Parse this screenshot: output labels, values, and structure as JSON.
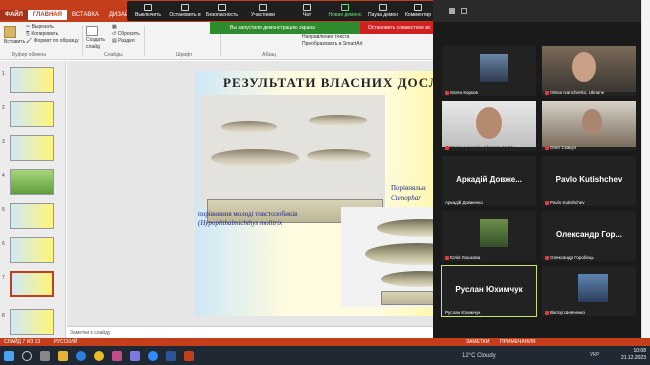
{
  "ribbon": {
    "tabs": [
      "ФАЙЛ",
      "ГЛАВНАЯ",
      "ВСТАВКА",
      "ДИЗАЙН"
    ],
    "paste_label": "Вставить",
    "cut_label": "Вырезать",
    "copy_label": "Копировать",
    "format_label": "Формат по образцу",
    "new_slide_label": "Создать слайд",
    "reset_label": "Сбросить",
    "section_label": "Раздел",
    "clipboard_group": "Буфер обмена",
    "slides_group": "Слайды",
    "font_group": "Шрифт",
    "paragraph_group": "Абзац",
    "text_direction": "Направление текста",
    "align_text": "Выровнять текст",
    "smartart": "Преобразовать в SmartArt"
  },
  "zoom_toolbar": {
    "items": [
      "Выключить",
      "Остановить в",
      "Безопасность",
      "Участники",
      "Чат",
      "Новая демонс",
      "Пауза демон",
      "Комментир"
    ],
    "share_bar": "Вы запустили демонстрацию экрана",
    "stop_button": "Остановить совместное ис"
  },
  "slide": {
    "title": "РЕЗУЛЬТАТИ ВЛАСНИХ ДОСЛІД",
    "caption_line1": "порівняння молоді товстолобиків",
    "caption_line2": "(Hypophthalmichthys molitrix",
    "compare_line1": "Порівняльн",
    "compare_line2": "Ctenophar"
  },
  "thumbnails": [
    "1",
    "2",
    "3",
    "4",
    "5",
    "6",
    "7",
    "8"
  ],
  "notes_placeholder": "Заметки к слайду",
  "status_bar": {
    "slide_info": "СЛАЙД 7 ИЗ 13",
    "language": "РУССКИЙ",
    "notes_btn": "ЗАМЕТКИ",
    "comments_btn": "ПРИМЕЧАНИЯ"
  },
  "participants": [
    {
      "name": "Євген Корков",
      "display": ""
    },
    {
      "name": "Olena Ivanchenko, Ukraine",
      "display": ""
    },
    {
      "name": "Sergiy Lavrenko Kherson SAEU",
      "display": ""
    },
    {
      "name": "Олег Скакун",
      "display": ""
    },
    {
      "name": "Аркадій Довженко",
      "display": "Аркадій Довже..."
    },
    {
      "name": "Pavlo Kutishchev",
      "display": "Pavlo Kutishchev"
    },
    {
      "name": "Юлія Лошкова",
      "display": ""
    },
    {
      "name": "Олександр Горобець",
      "display": "Олександр Гор..."
    },
    {
      "name": "Руслан Юхимчук",
      "display": "Руслан Юхимчук"
    },
    {
      "name": "Віктор Шевченко",
      "display": ""
    }
  ],
  "taskbar": {
    "weather": "12°C  Cloudy",
    "time": "10:08",
    "date": "21.12.2023",
    "lang": "УКР"
  }
}
